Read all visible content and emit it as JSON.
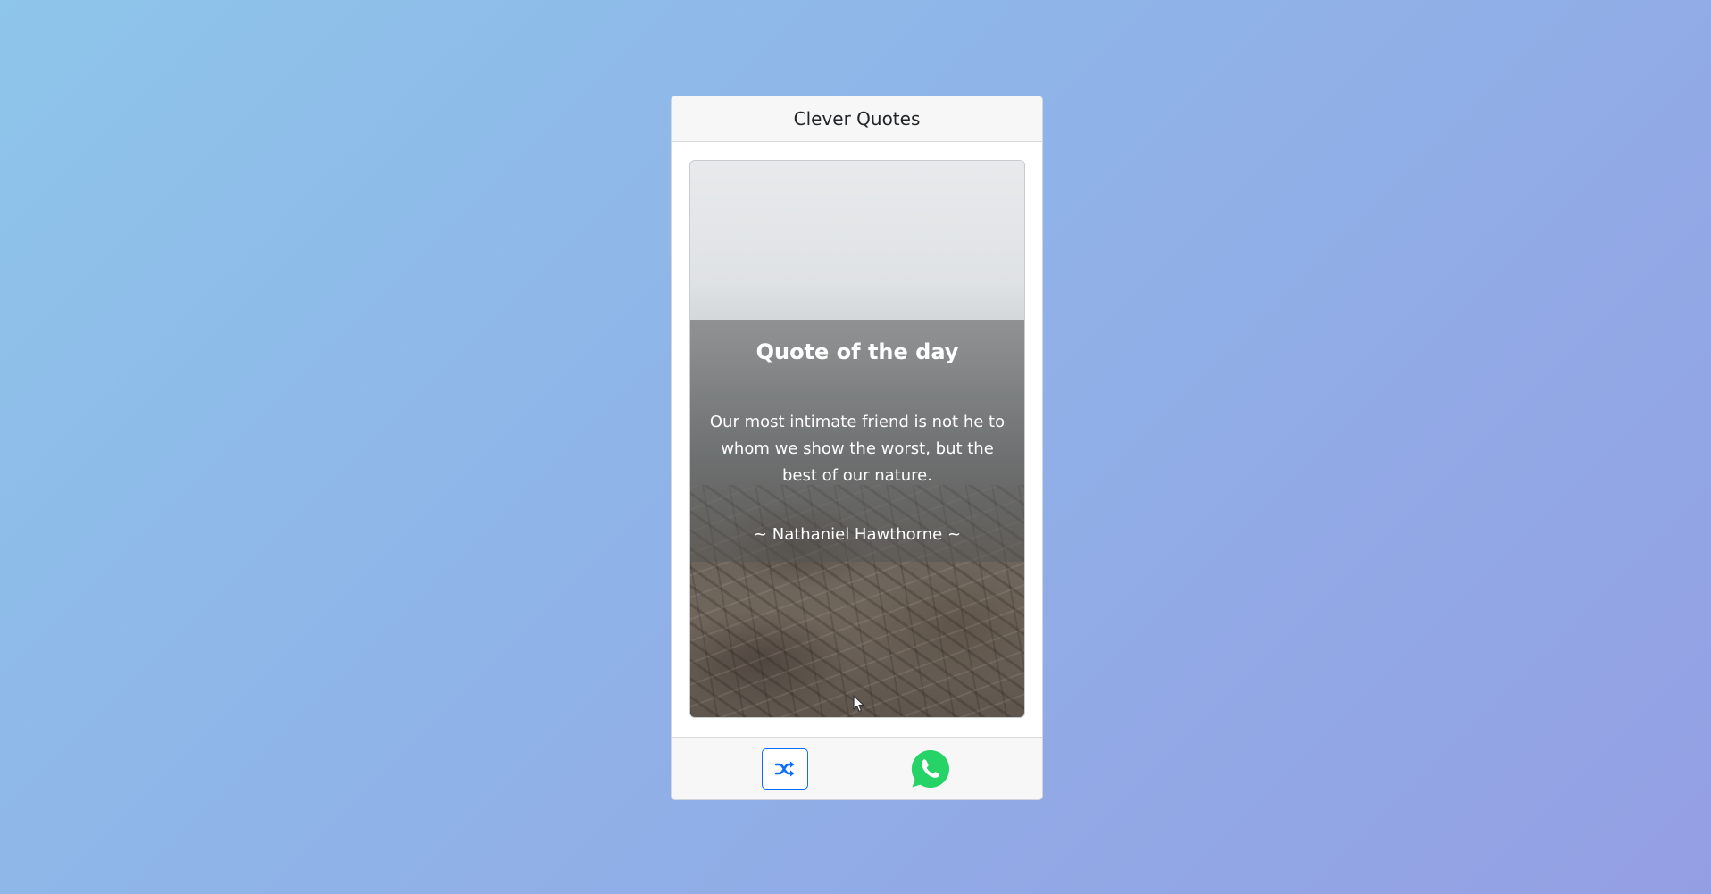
{
  "app": {
    "title": "Clever Quotes"
  },
  "quote": {
    "heading": "Quote of the day",
    "text": "Our most intimate friend is not he to whom we show the worst, but the best of our nature.",
    "author": "~ Nathaniel Hawthorne ~"
  },
  "footer": {
    "shuffle_icon": "shuffle-icon",
    "share_icon": "whatsapp-icon"
  },
  "colors": {
    "accent": "#0d6efd",
    "whatsapp": "#25d366"
  }
}
